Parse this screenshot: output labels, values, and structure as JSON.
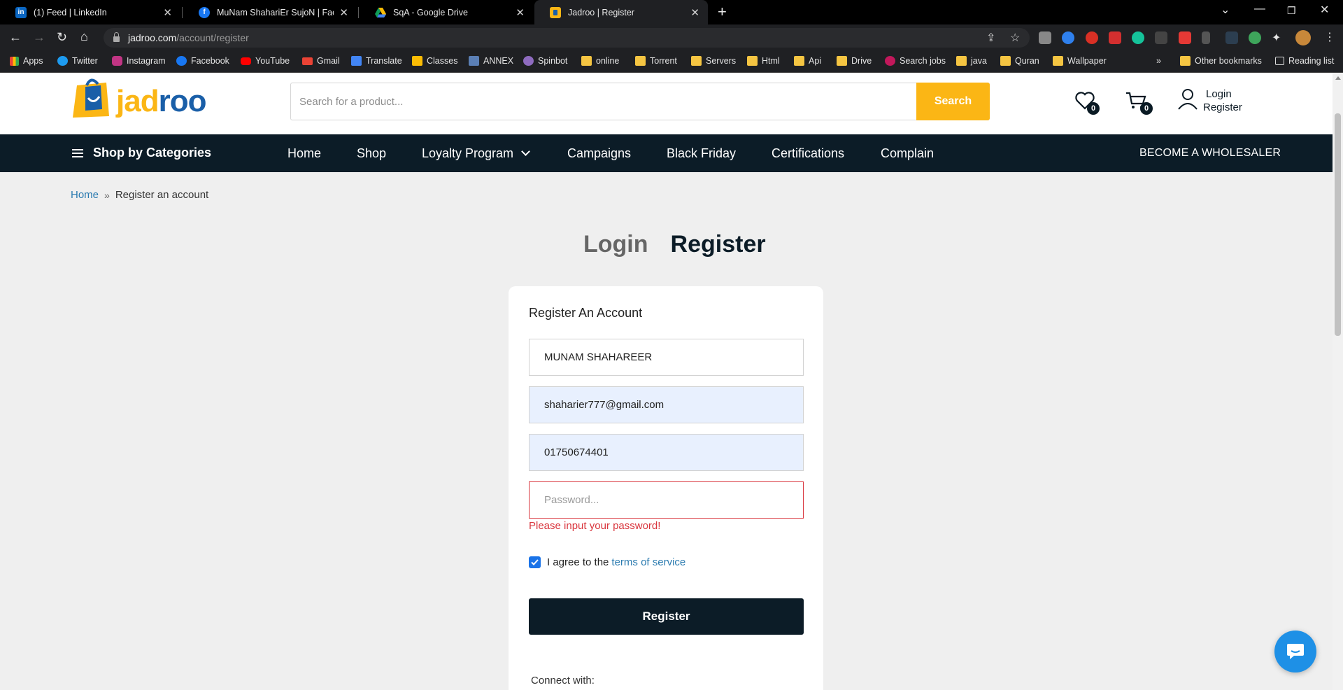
{
  "browser": {
    "tabs": [
      {
        "title": "(1) Feed | LinkedIn",
        "icon": "linkedin-icon"
      },
      {
        "title": "MuNam ShahariEr SujoN | Facebook",
        "icon": "facebook-icon"
      },
      {
        "title": "SqA - Google Drive",
        "icon": "google-drive-icon"
      },
      {
        "title": "Jadroo | Register",
        "icon": "jadroo-icon",
        "active": true
      }
    ],
    "url_host": "jadroo.com",
    "url_path": "/account/register",
    "bookmarks": [
      "Apps",
      "Twitter",
      "Instagram",
      "Facebook",
      "YouTube",
      "Gmail",
      "Translate",
      "Classes",
      "ANNEX",
      "Spinbot",
      "online",
      "Torrent",
      "Servers",
      "Html",
      "Api",
      "Drive",
      "Search jobs",
      "java",
      "Quran",
      "Wallpaper"
    ],
    "overflow": "»",
    "other_bookmarks": "Other bookmarks",
    "reading_list": "Reading list"
  },
  "header": {
    "logo_text": "jadroo",
    "search_placeholder": "Search for a product...",
    "search_label": "Search",
    "wishlist_count": "0",
    "cart_count": "0",
    "login_label": "Login",
    "register_label": "Register"
  },
  "nav": {
    "categories_label": "Shop by Categories",
    "links": [
      "Home",
      "Shop",
      "Loyalty Program",
      "Campaigns",
      "Black Friday",
      "Certifications",
      "Complain"
    ],
    "wholesaler_label": "BECOME A WHOLESALER"
  },
  "breadcrumb": {
    "home": "Home",
    "current": "Register an account"
  },
  "auth_tabs": {
    "login": "Login",
    "register": "Register"
  },
  "form": {
    "title": "Register An Account",
    "name_value": "MUNAM SHAHAREER",
    "email_value": "shaharier777@gmail.com",
    "phone_value": "01750674401",
    "password_placeholder": "Password...",
    "password_error": "Please input your password!",
    "agree_prefix": "I agree to the",
    "agree_link": "terms of service",
    "agree_checked": true,
    "submit_label": "Register",
    "connect_label": "Connect with:"
  },
  "colors": {
    "brand_yellow": "#fbb615",
    "nav_dark": "#0c1c27",
    "link_blue": "#2b7bb0",
    "error_red": "#d9363e",
    "chat_blue": "#1e90e6"
  }
}
